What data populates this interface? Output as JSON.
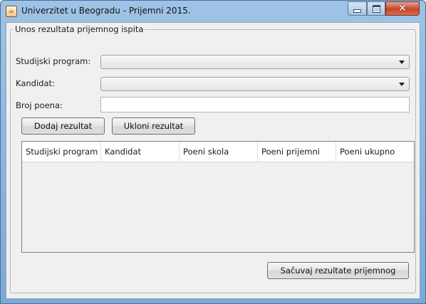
{
  "window": {
    "title": "Univerzitet u Beogradu - Prijemni 2015.",
    "icon": "java-cup-icon",
    "controls": {
      "minimize": "minimize",
      "maximize": "maximize",
      "close": "close"
    }
  },
  "form": {
    "group_title": "Unos rezultata prijemnog ispita",
    "program_label": "Studijski program:",
    "program_value": "",
    "candidate_label": "Kandidat:",
    "candidate_value": "",
    "points_label": "Broj poena:",
    "points_value": "",
    "add_button": "Dodaj rezultat",
    "remove_button": "Ukloni rezultat",
    "save_button": "Sačuvaj rezultate prijemnog"
  },
  "table": {
    "columns": [
      "Studijski program",
      "Kandidat",
      "Poeni skola",
      "Poeni prijemni",
      "Poeni ukupno"
    ],
    "rows": []
  },
  "colors": {
    "title_bar": "#9fc3e6",
    "close_button": "#c4452b",
    "client_bg": "#f0f0f0"
  }
}
